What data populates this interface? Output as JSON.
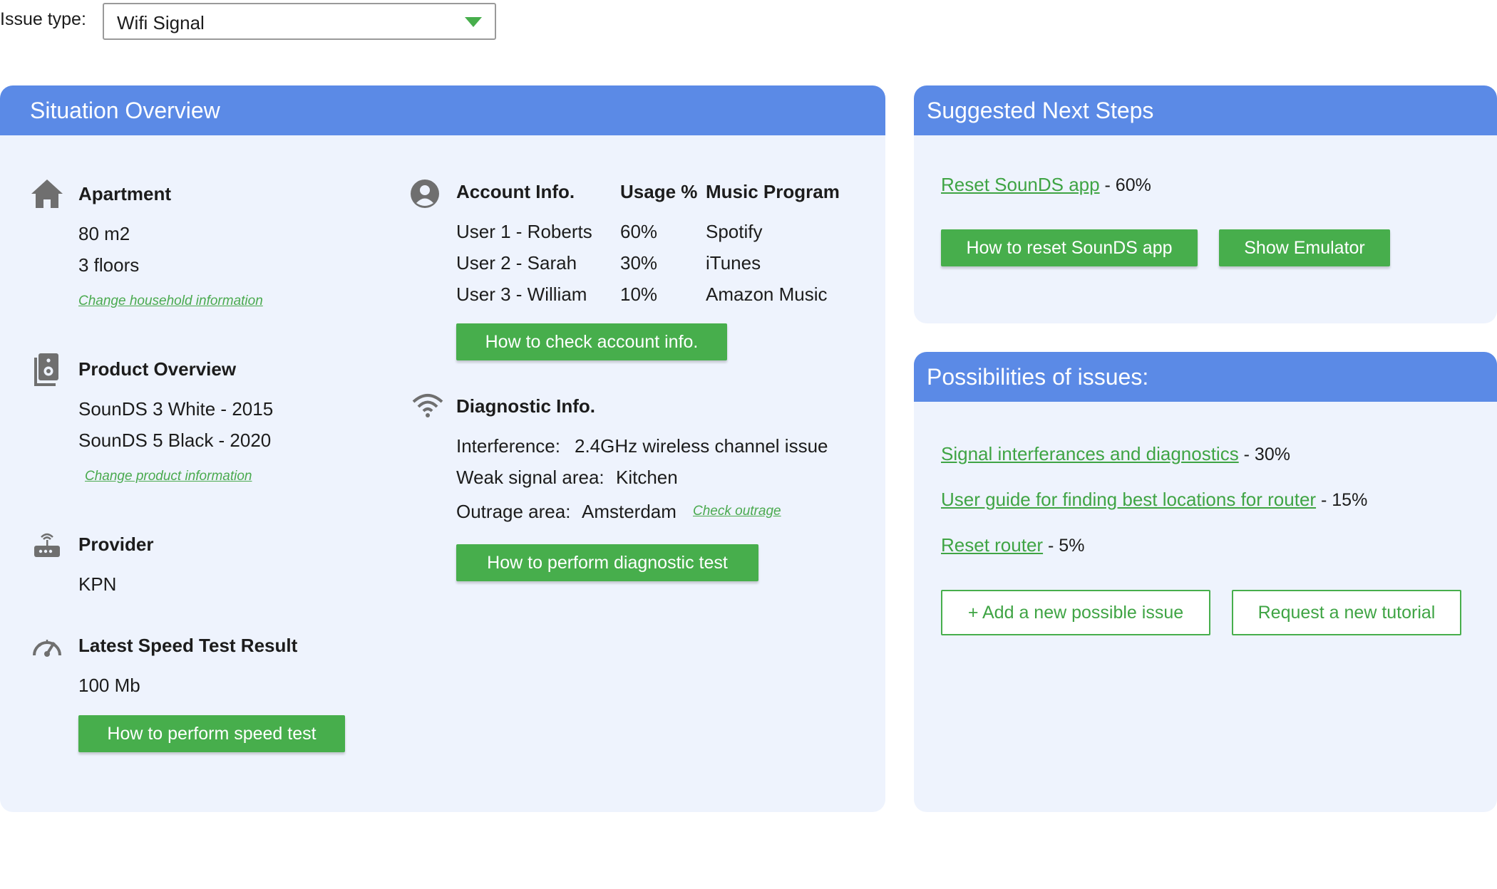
{
  "issue_type": {
    "label": "Issue type:",
    "value": "Wifi Signal"
  },
  "overview": {
    "title": "Situation Overview",
    "apartment": {
      "heading": "Apartment",
      "lines": [
        "80 m2",
        "3 floors"
      ],
      "link": "Change household information"
    },
    "product": {
      "heading": "Product Overview",
      "lines": [
        "SounDS 3 White - 2015",
        "SounDS 5 Black - 2020"
      ],
      "link": "Change product information"
    },
    "provider": {
      "heading": "Provider",
      "value": "KPN"
    },
    "speed": {
      "heading": "Latest Speed Test Result",
      "value": "100 Mb",
      "button": "How to perform speed test"
    },
    "account": {
      "headers": [
        "Account Info.",
        "Usage %",
        "Music Program"
      ],
      "rows": [
        [
          "User 1 - Roberts",
          "60%",
          "Spotify"
        ],
        [
          "User 2 - Sarah",
          "30%",
          "iTunes"
        ],
        [
          "User 3 - William",
          "10%",
          "Amazon Music"
        ]
      ],
      "button": "How to check account info."
    },
    "diagnostic": {
      "heading": "Diagnostic Info.",
      "interference_label": "Interference:",
      "interference_value": "2.4GHz wireless channel issue",
      "weak_label": "Weak signal area:",
      "weak_value": "Kitchen",
      "outage_label": "Outrage area:",
      "outage_value": "Amsterdam",
      "outage_link": "Check outrage",
      "button": "How to perform diagnostic test"
    }
  },
  "next_steps": {
    "title": "Suggested Next Steps",
    "step_link": "Reset SounDS app",
    "step_pct": " - 60%",
    "button_reset": "How to reset SounDS app",
    "button_emulator": "Show Emulator"
  },
  "issues": {
    "title": "Possibilities of issues:",
    "items": [
      {
        "link": "Signal interferances and diagnostics",
        "pct": " - 30%"
      },
      {
        "link": "User guide for finding best locations for router",
        "pct": " - 15%"
      },
      {
        "link": "Reset router",
        "pct": " - 5%"
      }
    ],
    "add_button": "+ Add a new possible issue",
    "tutorial_button": "Request a new tutorial"
  },
  "colors": {
    "header": "#5b8ae6",
    "panel": "#eef3fd",
    "green": "#47ae4c",
    "icon": "#6f6f6f"
  }
}
